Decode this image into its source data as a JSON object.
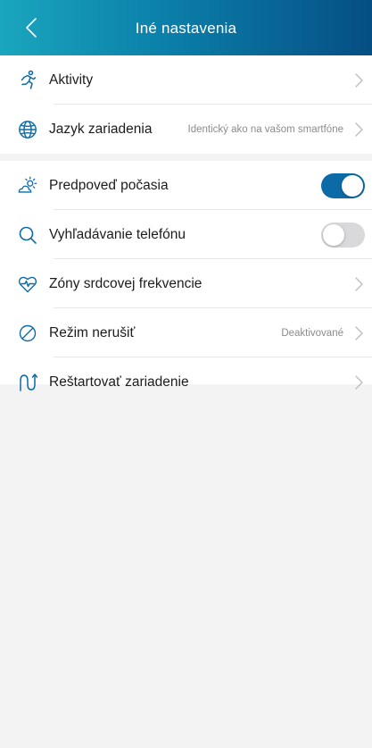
{
  "header": {
    "title": "Iné nastavenia",
    "back_icon": "chevron-left-icon"
  },
  "colors": {
    "accent": "#0c6ba6",
    "toggle_off": "#d9d9dc",
    "header_gradient": [
      "#1aa6be",
      "#0b7fa9",
      "#064e84"
    ],
    "value_text": "#8c8c8c"
  },
  "group1": {
    "items": [
      {
        "icon": "running-person-icon",
        "label": "Aktivity"
      },
      {
        "icon": "globe-icon",
        "label": "Jazyk zariadenia",
        "value": "Identický ako na vašom smartfóne"
      }
    ]
  },
  "group2": {
    "items": [
      {
        "icon": "weather-sun-cloud-icon",
        "label": "Predpoveď počasia",
        "toggle": true
      },
      {
        "icon": "search-icon",
        "label": "Vyhľadávanie telefónu",
        "toggle": false
      },
      {
        "icon": "heart-rate-icon",
        "label": "Zóny srdcovej frekvencie"
      },
      {
        "icon": "do-not-disturb-icon",
        "label": "Režim nerušiť",
        "value": "Deaktivované"
      },
      {
        "icon": "restart-icon",
        "label": "Reštartovať zariadenie"
      }
    ]
  }
}
